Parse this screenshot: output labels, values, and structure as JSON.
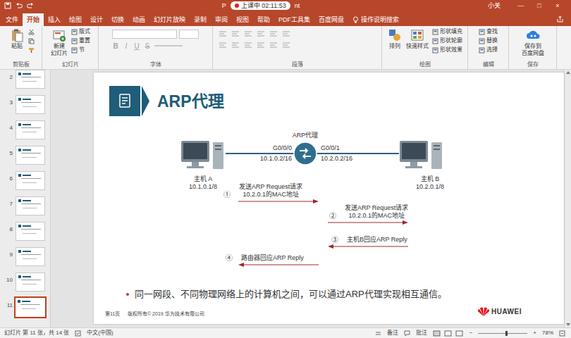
{
  "title_bar": {
    "fragment_left": "P",
    "recording": "上课中 02:11:53",
    "fragment_right": "nt",
    "user": "小关",
    "controls": [
      "—",
      "□",
      "×"
    ]
  },
  "tabs": [
    {
      "label": "文件",
      "selected": false
    },
    {
      "label": "开始",
      "selected": true
    },
    {
      "label": "插入",
      "selected": false
    },
    {
      "label": "绘图",
      "selected": false
    },
    {
      "label": "设计",
      "selected": false
    },
    {
      "label": "切换",
      "selected": false
    },
    {
      "label": "动画",
      "selected": false
    },
    {
      "label": "幻灯片放映",
      "selected": false
    },
    {
      "label": "录制",
      "selected": false
    },
    {
      "label": "审阅",
      "selected": false
    },
    {
      "label": "视图",
      "selected": false
    },
    {
      "label": "帮助",
      "selected": false
    },
    {
      "label": "PDF工具集",
      "selected": false
    },
    {
      "label": "百度网盘",
      "selected": false
    }
  ],
  "search": "操作说明搜索",
  "ribbon": {
    "groups": [
      {
        "kind": "clipboard",
        "label": "剪贴板",
        "large": [
          {
            "lines": [
              "粘贴"
            ]
          }
        ],
        "small": []
      },
      {
        "kind": "slides",
        "label": "幻灯片",
        "large": [
          {
            "lines": [
              "新建",
              "幻灯片"
            ]
          }
        ],
        "small": [
          "版式",
          "重置",
          "节"
        ]
      },
      {
        "kind": "font",
        "label": "字体",
        "disabled": true,
        "letters": [
          "B",
          "I",
          "U",
          "S"
        ],
        "large": [],
        "small": []
      },
      {
        "kind": "paragraph",
        "label": "段落",
        "disabled": true,
        "large": [],
        "small": []
      },
      {
        "kind": "drawing",
        "label": "绘图",
        "large": [
          {
            "lines": [
              "排列"
            ]
          },
          {
            "lines": [
              "快速样式"
            ]
          }
        ],
        "small": [
          "形状填充",
          "形状轮廓",
          "形状效果"
        ]
      },
      {
        "kind": "editing",
        "label": "编辑",
        "large": [],
        "small": [
          "查找",
          "替换",
          "选择"
        ]
      },
      {
        "kind": "save",
        "label": "保存",
        "large": [
          {
            "lines": [
              "保存到",
              "百度网盘"
            ]
          }
        ],
        "small": []
      }
    ]
  },
  "thumbnails": [
    {
      "number": "2",
      "selected": false
    },
    {
      "number": "3",
      "selected": false
    },
    {
      "number": "4",
      "selected": false
    },
    {
      "number": "5",
      "selected": false
    },
    {
      "number": "6",
      "selected": false
    },
    {
      "number": "7",
      "selected": false
    },
    {
      "number": "8",
      "selected": false
    },
    {
      "number": "9",
      "selected": false
    },
    {
      "number": "10",
      "selected": false
    },
    {
      "number": "11",
      "selected": true
    }
  ],
  "slide": {
    "title": "ARP代理",
    "router_label": "ARP代理",
    "hosts": [
      {
        "name": "主机 A",
        "ip": "10.1.0.1/8"
      },
      {
        "name": "主机 B",
        "ip": "10.2.0.1/8"
      }
    ],
    "interfaces": [
      {
        "name": "G0/0/0",
        "ip": "10.1.0.2/16"
      },
      {
        "name": "G0/0/1",
        "ip": "10.2.0.2/16"
      }
    ],
    "steps": [
      {
        "number": "①",
        "lines": [
          "发送ARP Request请求",
          "10.2.0.1的MAC地址"
        ],
        "direction": "right",
        "side": "a"
      },
      {
        "number": "②",
        "lines": [
          "发送ARP Request请求",
          "10.2.0.1的MAC地址"
        ],
        "direction": "right",
        "side": "b"
      },
      {
        "number": "③",
        "lines": [
          "主机B回应ARP Reply"
        ],
        "direction": "left",
        "side": "b"
      },
      {
        "number": "④",
        "lines": [
          "路由器回应ARP Reply"
        ],
        "direction": "left",
        "side": "a"
      }
    ],
    "bullet": "同一网段、不同物理网络上的计算机之间，可以通过ARP代理实现相互通信。",
    "footer": {
      "page": "第11页",
      "copyright": "版权所有© 2019 华为技术有限公司",
      "logo": "HUAWEI"
    }
  },
  "status_bar": {
    "slide_info": "幻灯片 第 11 张，共 14 张",
    "language": "中文(中国)",
    "notes": "备注",
    "comments": "批注",
    "zoom_minus": "−",
    "zoom_plus": "+",
    "zoom": "78%",
    "zoom_level": 0.55
  }
}
